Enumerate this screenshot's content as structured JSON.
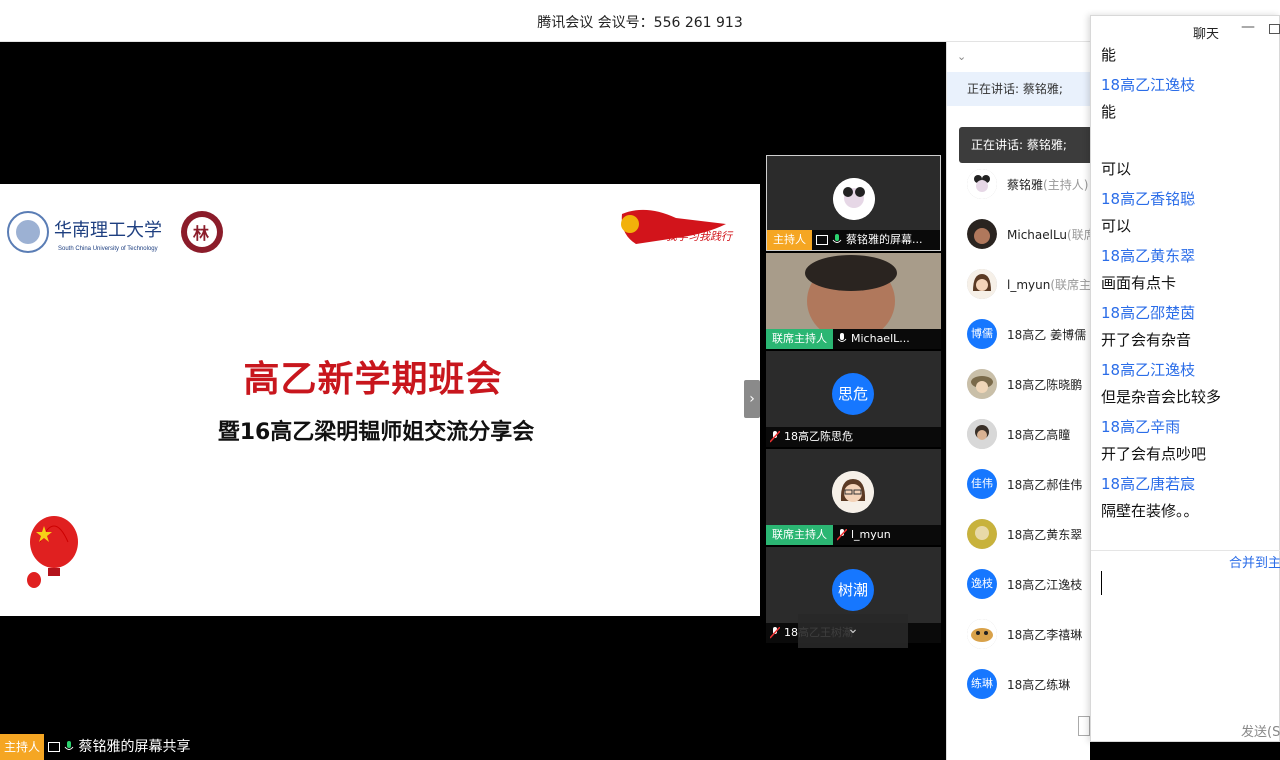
{
  "window": {
    "title": "腾讯会议 会议号：556 261 913"
  },
  "slide": {
    "logo_text": "华南理工大学",
    "logo_sub": "South China University of Technology",
    "main_title": "高乙新学期班会",
    "sub_title": "暨16高乙梁明韫师姐交流分享会"
  },
  "strip": {
    "tiles": [
      {
        "role": "主持人",
        "name": "蔡铭雅的屏幕..."
      },
      {
        "role": "联席主持人",
        "name": "MichaelL..."
      },
      {
        "avatar_text": "思危",
        "name": "18高乙陈思危"
      },
      {
        "role": "联席主持人",
        "name": "l_myun"
      },
      {
        "avatar_text": "树潮",
        "name": "18高乙王树潮"
      }
    ]
  },
  "bottom": {
    "role": "主持人",
    "name": "蔡铭雅的屏幕共享"
  },
  "members": {
    "speaking": "正在讲话: 蔡铭雅;",
    "list": [
      {
        "name": "蔡铭雅",
        "role": "(主持人)"
      },
      {
        "name": "MichaelLu",
        "role": "(联席"
      },
      {
        "name": "l_myun",
        "role": "(联席主"
      },
      {
        "avatar_text": "博儒",
        "name": "18高乙 姜博儒"
      },
      {
        "name": "18高乙陈晓鹏"
      },
      {
        "name": "18高乙高瞳"
      },
      {
        "avatar_text": "佳伟",
        "name": "18高乙郝佳伟"
      },
      {
        "name": "18高乙黄东翠"
      },
      {
        "avatar_text": "逸枝",
        "name": "18高乙江逸枝"
      },
      {
        "name": "18高乙李禧琳"
      },
      {
        "avatar_text": "练琳",
        "name": "18高乙练琳"
      }
    ]
  },
  "tooltip": {
    "text": "正在讲话: 蔡铭雅;"
  },
  "chat": {
    "title": "聊天",
    "lines": [
      {
        "kind": "text",
        "text": "能"
      },
      {
        "kind": "sender",
        "text": "18高乙江逸枝"
      },
      {
        "kind": "text",
        "text": "能"
      },
      {
        "kind": "text",
        "text": "可以"
      },
      {
        "kind": "sender",
        "text": "18高乙香铭聪"
      },
      {
        "kind": "text",
        "text": "可以"
      },
      {
        "kind": "sender",
        "text": "18高乙黄东翠"
      },
      {
        "kind": "text",
        "text": "画面有点卡"
      },
      {
        "kind": "sender",
        "text": "18高乙邵楚茵"
      },
      {
        "kind": "text",
        "text": "开了会有杂音"
      },
      {
        "kind": "sender",
        "text": "18高乙江逸枝"
      },
      {
        "kind": "text",
        "text": "但是杂音会比较多"
      },
      {
        "kind": "sender",
        "text": "18高乙辛雨"
      },
      {
        "kind": "text",
        "text": "开了会有点吵吧"
      },
      {
        "kind": "sender",
        "text": "18高乙唐若宸"
      },
      {
        "kind": "text",
        "text": "隔壁在装修。。"
      }
    ],
    "merge_label": "合并到主",
    "send_label": "发送(S"
  },
  "colors": {
    "accent": "#2b6de8",
    "host": "#f5a623",
    "cohost": "#2bb673",
    "title_red": "#c8161d"
  }
}
